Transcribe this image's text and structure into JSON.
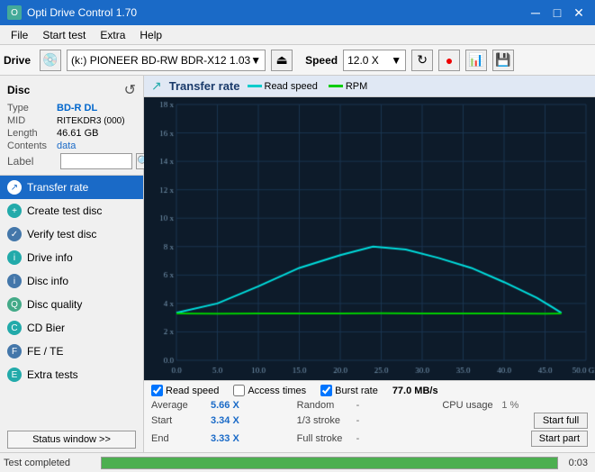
{
  "titleBar": {
    "title": "Opti Drive Control 1.70",
    "minimize": "─",
    "maximize": "□",
    "close": "✕"
  },
  "menuBar": {
    "items": [
      "File",
      "Start test",
      "Extra",
      "Help"
    ]
  },
  "toolbar": {
    "driveLabel": "Drive",
    "driveIcon": "💿",
    "driveName": "(k:) PIONEER BD-RW   BDR-X12 1.03",
    "ejectLabel": "⏏",
    "speedLabel": "Speed",
    "speedValue": "12.0 X",
    "refreshIcon": "↻",
    "icon1": "🔴",
    "icon2": "📊",
    "icon3": "💾"
  },
  "disc": {
    "title": "Disc",
    "typeLabel": "Type",
    "typeValue": "BD-R DL",
    "midLabel": "MID",
    "midValue": "RITEKDR3 (000)",
    "lengthLabel": "Length",
    "lengthValue": "46.61 GB",
    "contentsLabel": "Contents",
    "contentsValue": "data",
    "labelLabel": "Label",
    "labelValue": ""
  },
  "nav": {
    "items": [
      {
        "id": "transfer-rate",
        "label": "Transfer rate",
        "active": true
      },
      {
        "id": "create-test-disc",
        "label": "Create test disc",
        "active": false
      },
      {
        "id": "verify-test-disc",
        "label": "Verify test disc",
        "active": false
      },
      {
        "id": "drive-info",
        "label": "Drive info",
        "active": false
      },
      {
        "id": "disc-info",
        "label": "Disc info",
        "active": false
      },
      {
        "id": "disc-quality",
        "label": "Disc quality",
        "active": false
      },
      {
        "id": "cd-bier",
        "label": "CD Bier",
        "active": false
      },
      {
        "id": "fe-te",
        "label": "FE / TE",
        "active": false
      },
      {
        "id": "extra-tests",
        "label": "Extra tests",
        "active": false
      }
    ],
    "statusButton": "Status window >>"
  },
  "chart": {
    "title": "Transfer rate",
    "legend": [
      {
        "label": "Read speed",
        "color": "cyan"
      },
      {
        "label": "RPM",
        "color": "green"
      }
    ],
    "yAxisMax": 18,
    "yAxisMin": 0,
    "xAxisMax": 50,
    "xAxisMin": 0,
    "yLabels": [
      "18 x",
      "16 x",
      "14 x",
      "12 x",
      "10 x",
      "8 x",
      "6 x",
      "4 x",
      "2 x",
      "0.0"
    ],
    "xLabels": [
      "0.0",
      "5.0",
      "10.0",
      "15.0",
      "20.0",
      "25.0",
      "30.0",
      "35.0",
      "40.0",
      "45.0",
      "50.0 GB"
    ]
  },
  "checkboxes": {
    "readSpeed": {
      "label": "Read speed",
      "checked": true
    },
    "accessTimes": {
      "label": "Access times",
      "checked": false
    },
    "burstRate": {
      "label": "Burst rate",
      "checked": true
    },
    "burstValue": "77.0 MB/s"
  },
  "stats": {
    "average": {
      "label": "Average",
      "value": "5.66 X"
    },
    "random": {
      "label": "Random",
      "value": "-"
    },
    "cpuUsage": {
      "label": "CPU usage",
      "value": "1 %"
    },
    "start": {
      "label": "Start",
      "value": "3.34 X"
    },
    "stroke13": {
      "label": "1/3 stroke",
      "value": "-"
    },
    "startFull": "Start full",
    "end": {
      "label": "End",
      "value": "3.33 X"
    },
    "fullStroke": {
      "label": "Full stroke",
      "value": "-"
    },
    "startPart": "Start part"
  },
  "statusBar": {
    "text": "Test completed",
    "progress": 100,
    "time": "0:03"
  }
}
